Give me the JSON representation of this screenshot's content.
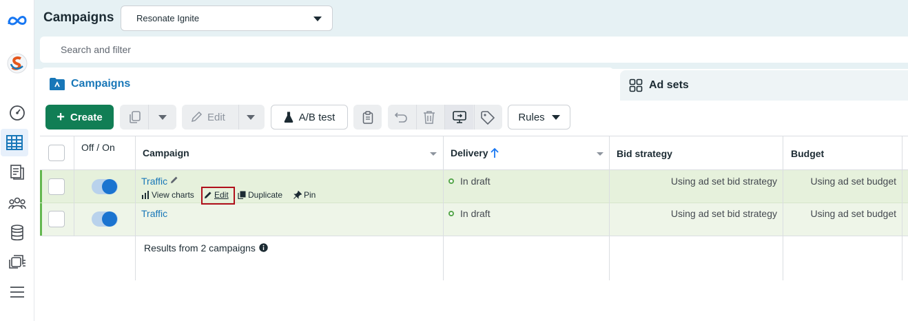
{
  "rail": {
    "icons": [
      "meta-logo-icon",
      "app-logo-icon",
      "dashboard-icon",
      "table-icon",
      "document-icon",
      "audience-icon",
      "database-icon",
      "media-icon",
      "menu-icon"
    ]
  },
  "header": {
    "title": "Campaigns",
    "account": "Resonate Ignite",
    "search_placeholder": "Search and filter"
  },
  "tabs": {
    "campaigns": "Campaigns",
    "adsets": "Ad sets"
  },
  "toolbar": {
    "create": "Create",
    "edit": "Edit",
    "ab_test": "A/B test",
    "rules": "Rules"
  },
  "table": {
    "headers": {
      "onoff": "Off / On",
      "campaign": "Campaign",
      "delivery": "Delivery",
      "bid": "Bid strategy",
      "budget": "Budget"
    },
    "rows": [
      {
        "name": "Traffic",
        "delivery": "In draft",
        "bid": "Using ad set bid strategy",
        "budget": "Using ad set budget",
        "actions": {
          "charts": "View charts",
          "edit": "Edit",
          "duplicate": "Duplicate",
          "pin": "Pin"
        }
      },
      {
        "name": "Traffic",
        "delivery": "In draft",
        "bid": "Using ad set bid strategy",
        "budget": "Using ad set budget"
      }
    ],
    "results": "Results from 2 campaigns"
  }
}
